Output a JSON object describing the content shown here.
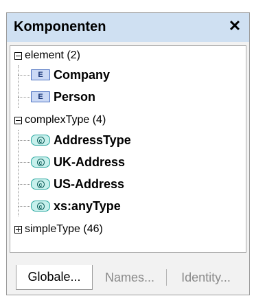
{
  "panel": {
    "title": "Komponenten",
    "close_icon": "close-icon"
  },
  "tree": {
    "groups": [
      {
        "label": "element (2)",
        "state": "expanded",
        "items": [
          {
            "badge": "E",
            "label": "Company"
          },
          {
            "badge": "E",
            "label": "Person"
          }
        ]
      },
      {
        "label": "complexType (4)",
        "state": "expanded",
        "items": [
          {
            "badge": "c",
            "label": "AddressType"
          },
          {
            "badge": "c",
            "label": "UK-Address"
          },
          {
            "badge": "c",
            "label": "US-Address"
          },
          {
            "badge": "c",
            "label": "xs:anyType"
          }
        ]
      },
      {
        "label": "simpleType (46)",
        "state": "collapsed",
        "items": []
      }
    ]
  },
  "tabs": [
    {
      "label": "Globale...",
      "active": true
    },
    {
      "label": "Names...",
      "active": false
    },
    {
      "label": "Identity...",
      "active": false
    }
  ]
}
